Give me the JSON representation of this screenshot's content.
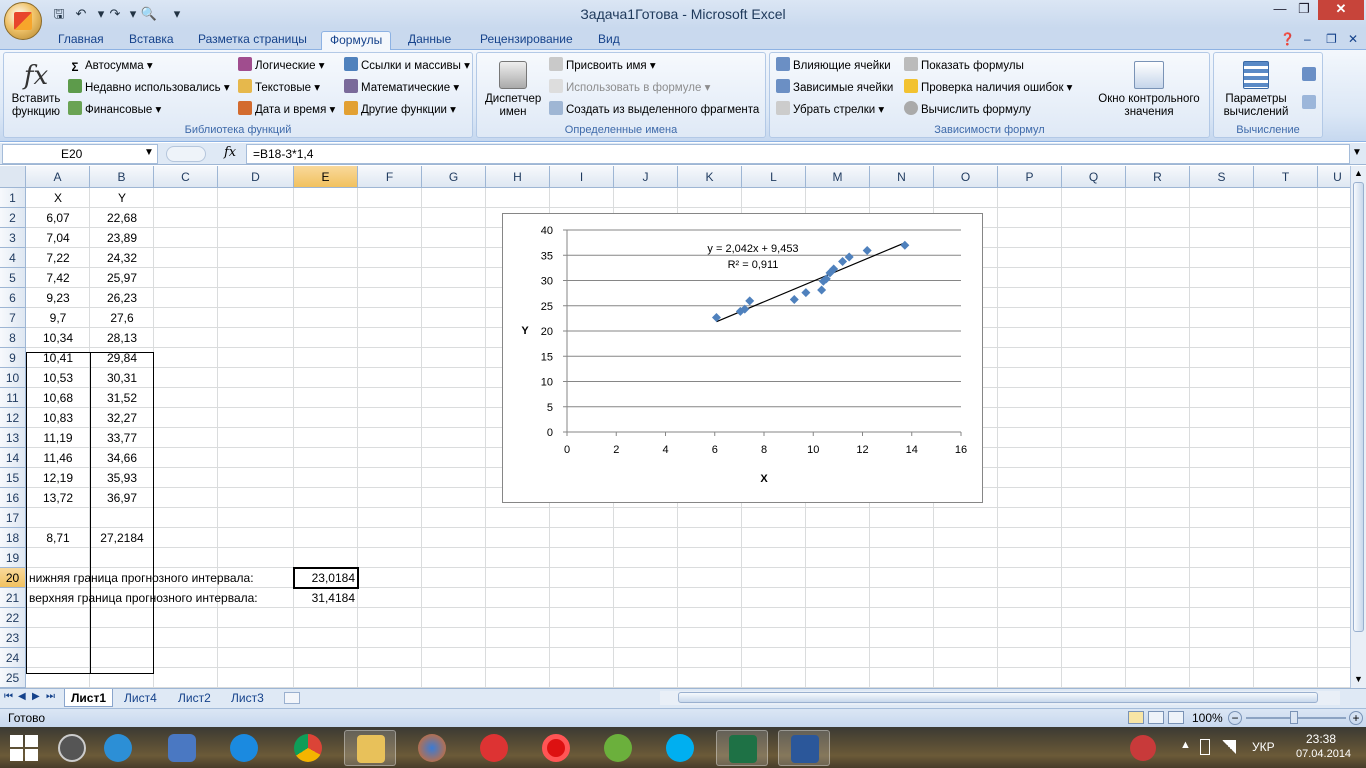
{
  "window": {
    "title": "Задача1Готова - Microsoft Excel"
  },
  "ribbon": {
    "tabs": [
      "Главная",
      "Вставка",
      "Разметка страницы",
      "Формулы",
      "Данные",
      "Рецензирование",
      "Вид"
    ],
    "active_tab": "Формулы",
    "function_library": {
      "insert_function": "Вставить функцию",
      "autosum": "Автосумма",
      "recent": "Недавно использовались",
      "financial": "Финансовые",
      "logical": "Логические",
      "text": "Текстовые",
      "datetime": "Дата и время",
      "references": "Ссылки и массивы",
      "math": "Математические",
      "other": "Другие функции",
      "title": "Библиотека функций"
    },
    "defined_names": {
      "manager": "Диспетчер имен",
      "assign_name": "Присвоить имя",
      "use_in_formula": "Использовать в формуле",
      "create_from_selection": "Создать из выделенного фрагмента",
      "title": "Определенные имена"
    },
    "formula_auditing": {
      "trace_precedents": "Влияющие ячейки",
      "trace_dependents": "Зависимые ячейки",
      "remove_arrows": "Убрать стрелки",
      "show_formulas": "Показать формулы",
      "error_checking": "Проверка наличия ошибок",
      "evaluate_formula": "Вычислить формулу",
      "watch_window": "Окно контрольного значения",
      "title": "Зависимости формул"
    },
    "calculation": {
      "options": "Параметры вычислений",
      "title": "Вычисление"
    }
  },
  "formula_bar": {
    "name_box": "E20",
    "fx": "fx",
    "formula": "=B18-3*1,4"
  },
  "sheet": {
    "columns": [
      "A",
      "B",
      "C",
      "D",
      "E",
      "F",
      "G",
      "H",
      "I",
      "J",
      "K",
      "L",
      "M",
      "N",
      "O",
      "P",
      "Q",
      "R",
      "S",
      "T",
      "U"
    ],
    "rows": [
      "1",
      "2",
      "3",
      "4",
      "5",
      "6",
      "7",
      "8",
      "9",
      "10",
      "11",
      "12",
      "13",
      "14",
      "15",
      "16",
      "17",
      "18",
      "19",
      "20",
      "21",
      "22",
      "23",
      "24",
      "25"
    ],
    "headers": {
      "x": "X",
      "y": "Y"
    },
    "x_values": [
      "6,07",
      "7,04",
      "7,22",
      "7,42",
      "9,23",
      "9,7",
      "10,34",
      "10,41",
      "10,53",
      "10,68",
      "10,83",
      "11,19",
      "11,46",
      "12,19",
      "13,72"
    ],
    "y_values": [
      "22,68",
      "23,89",
      "24,32",
      "25,97",
      "26,23",
      "27,6",
      "28,13",
      "29,84",
      "30,31",
      "31,52",
      "32,27",
      "33,77",
      "34,66",
      "35,93",
      "36,97"
    ],
    "row18": {
      "a": "8,71",
      "b": "27,2184"
    },
    "row20": {
      "label": "нижняя граница прогнозного интервала:",
      "value": "23,0184"
    },
    "row21": {
      "label": "верхняя граница прогнозного интервала:",
      "value": "31,4184"
    }
  },
  "chart_data": {
    "type": "scatter",
    "x": [
      6.07,
      7.04,
      7.22,
      7.42,
      9.23,
      9.7,
      10.34,
      10.41,
      10.53,
      10.68,
      10.83,
      11.19,
      11.46,
      12.19,
      13.72
    ],
    "y": [
      22.68,
      23.89,
      24.32,
      25.97,
      26.23,
      27.6,
      28.13,
      29.84,
      30.31,
      31.52,
      32.27,
      33.77,
      34.66,
      35.93,
      36.97
    ],
    "trendline": {
      "slope": 2.042,
      "intercept": 9.453
    },
    "equation": "y = 2,042x + 9,453",
    "r2": "R² = 0,911",
    "xlabel": "X",
    "ylabel": "Y",
    "xlim": [
      0,
      16
    ],
    "ylim": [
      0,
      40
    ],
    "xticks": [
      "0",
      "2",
      "4",
      "6",
      "8",
      "10",
      "12",
      "14",
      "16"
    ],
    "yticks": [
      "0",
      "5",
      "10",
      "15",
      "20",
      "25",
      "30",
      "35",
      "40"
    ],
    "marker_color": "#4f81bd",
    "grid": "horizontal"
  },
  "sheet_tabs": [
    "Лист1",
    "Лист4",
    "Лист2",
    "Лист3"
  ],
  "active_sheet": "Лист1",
  "status": {
    "ready": "Готово",
    "zoom": "100%"
  },
  "taskbar": {
    "lang": "УКР",
    "time": "23:38",
    "date": "07.04.2014"
  }
}
